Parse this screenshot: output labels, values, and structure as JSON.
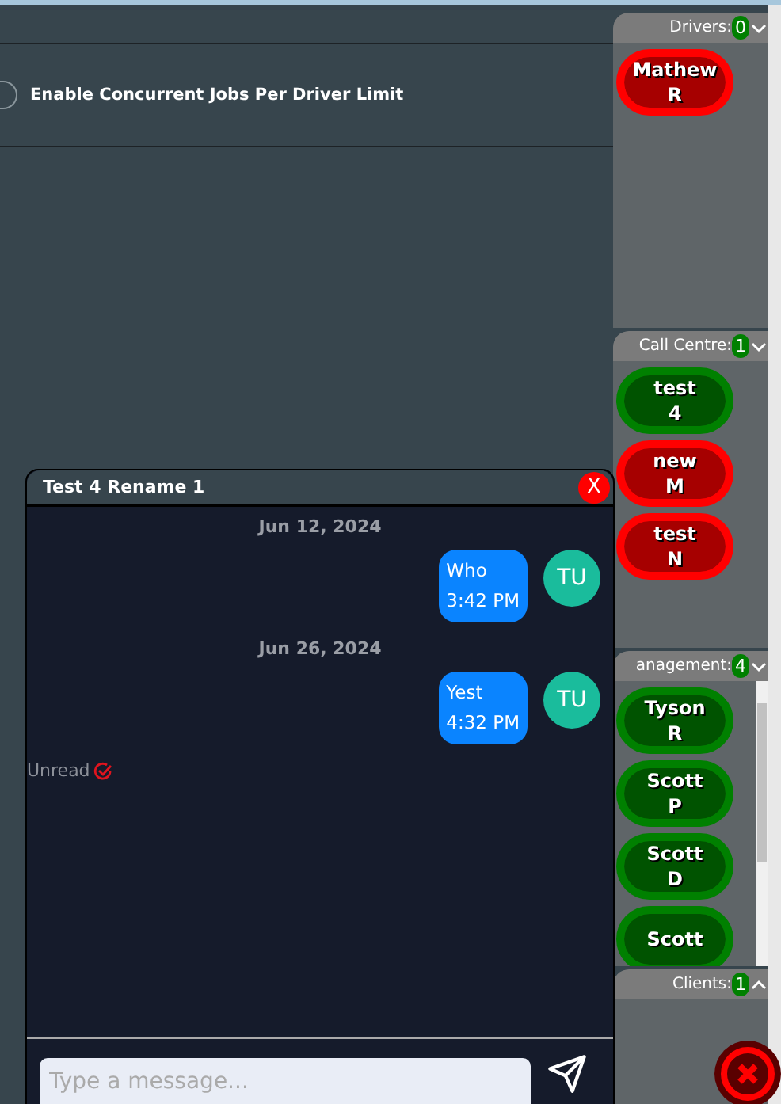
{
  "settings": {
    "label": "Enable Concurrent Jobs Per Driver Limit",
    "on": false
  },
  "groups": [
    {
      "title": "Drivers:",
      "count": "0",
      "expanded": true,
      "people": [
        {
          "first": "Mathew",
          "last": "R",
          "color": "#ff0000"
        }
      ]
    },
    {
      "title": "Call Centre:",
      "count": "1",
      "expanded": true,
      "people": [
        {
          "first": "test",
          "last": "4",
          "color": "#008000"
        },
        {
          "first": "new",
          "last": "M",
          "color": "#ff0000"
        },
        {
          "first": "test",
          "last": "N",
          "color": "#ff0000"
        }
      ]
    },
    {
      "title": "anagement:",
      "count": "4",
      "expanded": true,
      "people": [
        {
          "first": "Tyson",
          "last": "R",
          "color": "#008000"
        },
        {
          "first": "Scott",
          "last": "P",
          "color": "#008000"
        },
        {
          "first": "Scott",
          "last": "D",
          "color": "#008000"
        },
        {
          "first": "Scott",
          "color": "#008000"
        }
      ]
    },
    {
      "title": "Clients:",
      "count": "1",
      "expanded": false
    }
  ],
  "chat": {
    "title": "Test 4 Rename 1",
    "close": "X",
    "days": [
      {
        "date": "Jun 12, 2024",
        "messages": [
          {
            "text": "Who",
            "time": "3:42 PM",
            "avatar": "TU"
          }
        ]
      },
      {
        "date": "Jun 26, 2024",
        "messages": [
          {
            "text": "Yest",
            "time": "4:32 PM",
            "avatar": "TU"
          }
        ]
      }
    ],
    "status": "Unread",
    "placeholder": "Type a message..."
  }
}
